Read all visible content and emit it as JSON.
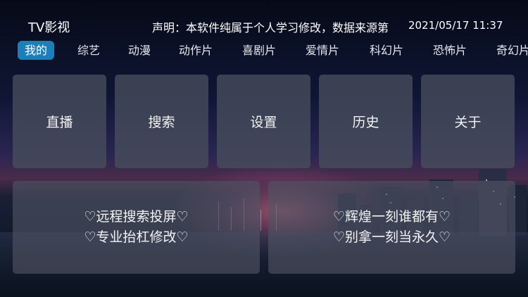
{
  "header": {
    "title": "TV影视",
    "notice": "声明：本软件纯属于个人学习修改，数据来源第",
    "datetime": "2021/05/17 11:37"
  },
  "tabs": [
    {
      "label": "我的",
      "active": true
    },
    {
      "label": "综艺"
    },
    {
      "label": "动漫"
    },
    {
      "label": "动作片"
    },
    {
      "label": "喜剧片"
    },
    {
      "label": "爱情片"
    },
    {
      "label": "科幻片"
    },
    {
      "label": "恐怖片"
    },
    {
      "label": "奇幻片"
    }
  ],
  "tiles": [
    {
      "label": "直播"
    },
    {
      "label": "搜索"
    },
    {
      "label": "设置"
    },
    {
      "label": "历史"
    },
    {
      "label": "关于"
    }
  ],
  "banners": [
    {
      "line1": "♡远程搜索投屏♡",
      "line2": "♡专业抬杠修改♡"
    },
    {
      "line1": "♡辉煌一刻谁都有♡",
      "line2": "♡别拿一刻当永久♡"
    }
  ],
  "colors": {
    "accent": "#1d7fb8",
    "tile_bg": "#484e5c"
  }
}
